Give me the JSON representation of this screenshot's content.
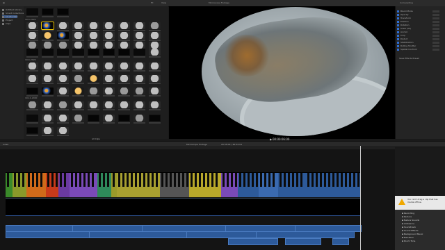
{
  "sidebar": {
    "items": [
      {
        "label": "Untitled Library",
        "icon": "library-icon"
      },
      {
        "label": "Smart Collections",
        "icon": "folder-icon"
      },
      {
        "label": "10-26-2020",
        "icon": "event-icon"
      },
      {
        "label": "Project",
        "icon": "event-icon"
      },
      {
        "label": "Clips",
        "icon": "event-icon"
      }
    ]
  },
  "browser": {
    "sections": [
      {
        "label": "10-5-2020"
      },
      {
        "label": "10-6-2020"
      },
      {
        "label": "10-11-2020"
      }
    ],
    "footer_label": "All Clips"
  },
  "viewer": {
    "title": "Microscope Footage",
    "zoom": "Fit",
    "view_label": "View",
    "timecode": "00:00:06:00"
  },
  "inspector": {
    "title": "Compositing",
    "rows": [
      "Blend Mode",
      "Opacity",
      "Transform",
      "Position",
      "Rotation",
      "Scale (All)",
      "Anchor",
      "Crop",
      "Distort",
      "Stabilization",
      "Rolling Shutter",
      "Spatial Conform"
    ],
    "footer": "Save Effects Preset"
  },
  "timeline": {
    "project_name": "Microscope Footage",
    "index_label": "Index",
    "duration_label": "29:35:04 / 36:24:19"
  },
  "notification": {
    "title": "You can't drag a clip that has media offline.",
    "rows": [
      "Recording",
      "Reduce",
      "Nature Sounds",
      "Ambience",
      "Soundtrack",
      "Sound Effects",
      "Background Music",
      "Narration",
      "Room Tone"
    ]
  },
  "colors": {
    "accent": "#f0a800",
    "selection": "#e8c000",
    "audio_clip": "#2d5a9a"
  }
}
